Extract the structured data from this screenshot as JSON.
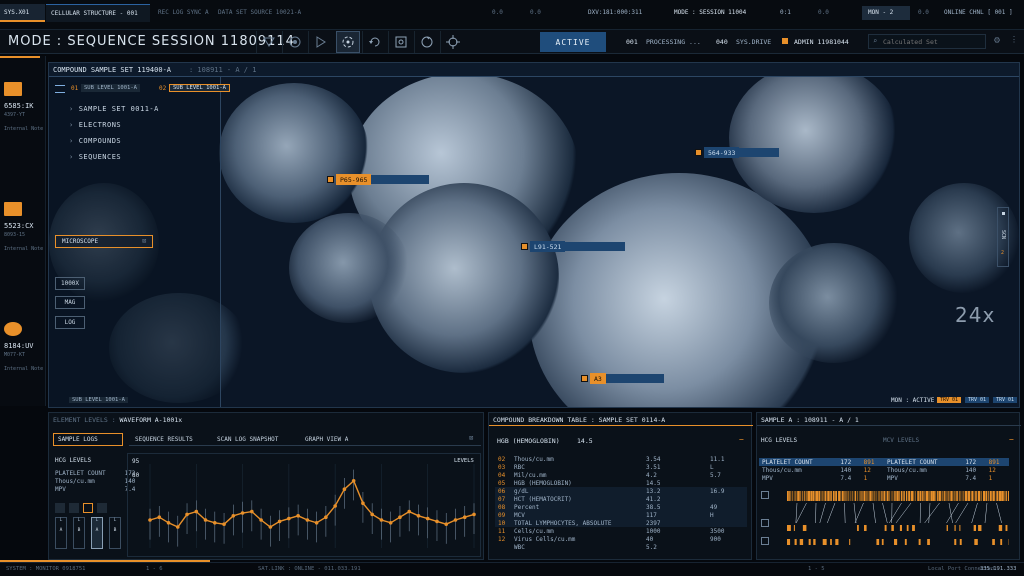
{
  "topbar": {
    "tab1": "SYS.X01",
    "tab2": "CELLULAR STRUCTURE - 001",
    "rec_log": "REC LOG SYNC A",
    "data_set": "DATA SET SOURCE 10021-A",
    "val1": "0.0",
    "val2": "0.0",
    "dxv": "DXV:181:000:311",
    "mode_session": "MODE : SESSION 11004",
    "ratio": "0:1",
    "val3": "0.0",
    "val4": "0.0",
    "mon": "MON - 2",
    "val5": "0.0",
    "online": "ONLINE CHNL [ 001 ]"
  },
  "header": {
    "title": "MODE : SEQUENCE SESSION 11809114",
    "active_label": "ACTIVE",
    "processing_id": "001",
    "processing": "PROCESSING ...",
    "sys_id": "040",
    "sys_drive": "SYS.DRIVE",
    "admin": "ADMIN 11981044",
    "search_placeholder": "Calculated Set"
  },
  "leftrail": {
    "items": [
      {
        "id": "6585:IK",
        "sub": "4397-YT",
        "note": "Internal Note"
      },
      {
        "id": "5523:CX",
        "sub": "8093-15",
        "note": "Internal Note"
      },
      {
        "id": "8184:UV",
        "sub": "M077-KT",
        "note": "Internal Note"
      }
    ]
  },
  "viewer": {
    "title": "COMPOUND SAMPLE SET 119400-A",
    "subtitle": ": 108911 - A / 1",
    "sub_level_a_num": "01",
    "sub_level_a": "SUB LEVEL 1001-A",
    "sub_level_b_num": "02",
    "sub_level_b": "SUB LEVEL 1001-A",
    "menu": [
      "SAMPLE SET 0011-A",
      "ELECTRONS",
      "COMPOUNDS",
      "SEQUENCES"
    ],
    "microscope_label": "MICROSCOPE",
    "buttons": [
      "1000X",
      "MAG",
      "LOG"
    ],
    "zoom": "24x",
    "scale_label": "SCN",
    "scale_value": "2",
    "bottom_sub_level": "SUB LEVEL 1001-A",
    "mon_status": "MON : ACTIVE",
    "trv": [
      "TRV 01",
      "TRV 01",
      "TRV 01"
    ],
    "tags": [
      "P65-965",
      "564-933",
      "L91-521",
      "A3"
    ]
  },
  "element_panel": {
    "title_prefix": "ELEMENT LEVELS :",
    "title": "WAVEFORM A-1001x",
    "sample_logs": "SAMPLE LOGS",
    "tabs": [
      "SEQUENCE RESULTS",
      "SCAN LOG SNAPSHOT",
      "GRAPH VIEW A"
    ],
    "hcg_levels": "HCG LEVELS",
    "rows": [
      {
        "label": "PLATELET COUNT",
        "value": "172"
      },
      {
        "label": "Thous/cu.mm",
        "value": "140"
      },
      {
        "label": "MPV",
        "value": "7.4"
      }
    ],
    "graph_max": "95",
    "graph_mid": "80",
    "graph_levels": "LEVELS",
    "side_labels": [
      "L",
      "L",
      "L",
      "L"
    ],
    "side_values": [
      "A",
      "B",
      "A",
      "B"
    ],
    "graph_values": [
      60,
      62,
      58,
      55,
      64,
      66,
      60,
      58,
      57,
      63,
      65,
      66,
      60,
      55,
      59,
      61,
      63,
      60,
      58,
      62,
      70,
      82,
      88,
      72,
      64,
      60,
      58,
      62,
      66,
      63,
      61,
      59,
      57,
      60,
      62,
      64
    ]
  },
  "breakdown_panel": {
    "title": "COMPOUND BREAKDOWN TABLE : SAMPLE SET 0114-A",
    "hgb_label": "HGB (HEMOGLOBIN)",
    "hgb_value": "14.5",
    "rows": [
      {
        "n": "02",
        "label": "Thous/cu.mm",
        "v1": "3.54",
        "v2": "11.1"
      },
      {
        "n": "03",
        "label": "RBC",
        "v1": "3.51",
        "v2": "L"
      },
      {
        "n": "04",
        "label": "Mil/cu.mm",
        "v1": "4.2",
        "v2": "5.7"
      },
      {
        "n": "05",
        "label": "HGB (HEMOGLOBIN)",
        "v1": "14.5",
        "v2": ""
      },
      {
        "n": "06",
        "label": "g/dL",
        "v1": "13.2",
        "v2": "16.9"
      },
      {
        "n": "07",
        "label": "HCT (HEMATOCRIT)",
        "v1": "41.2",
        "v2": ""
      },
      {
        "n": "08",
        "label": "Percent",
        "v1": "38.5",
        "v2": "49"
      },
      {
        "n": "09",
        "label": "MCV",
        "v1": "117",
        "v2": "H"
      },
      {
        "n": "10",
        "label": "TOTAL LYMPHOCYTES, ABSOLUTE",
        "v1": "2397",
        "v2": ""
      },
      {
        "n": "11",
        "label": "Cells/cu.mm",
        "v1": "1000",
        "v2": "3500"
      },
      {
        "n": "12",
        "label": "Virus Cells/cu.mm",
        "v1": "40",
        "v2": "900"
      },
      {
        "n": "",
        "label": "WBC",
        "v1": "5.2",
        "v2": ""
      }
    ]
  },
  "sample_panel": {
    "title": "SAMPLE A : 108911 - A / 1",
    "hcg_levels": "HCG LEVELS",
    "mcv_levels": "MCV LEVELS",
    "rows": [
      {
        "label": "PLATELET COUNT",
        "a": "172",
        "b": "891",
        "label2": "PLATELET COUNT",
        "c": "172",
        "d": "891"
      },
      {
        "label": "Thous/cu.mm",
        "a": "140",
        "b": "12",
        "label2": "Thous/cu.mm",
        "c": "140",
        "d": "12"
      },
      {
        "label": "MPV",
        "a": "7.4",
        "b": "1",
        "label2": "MPV",
        "c": "7.4",
        "d": "1"
      }
    ]
  },
  "footer": {
    "system": "SYSTEM : MONITOR 0918751",
    "page": "1 - 6",
    "sat_link": "SAT.LINK : ONLINE - 011.033.191",
    "page2": "1 - 5",
    "local": "Local Port Connected",
    "code": "335.191.333"
  },
  "colors": {
    "accent": "#e8902a",
    "active": "#1f4d7c",
    "background": "#05080d"
  }
}
